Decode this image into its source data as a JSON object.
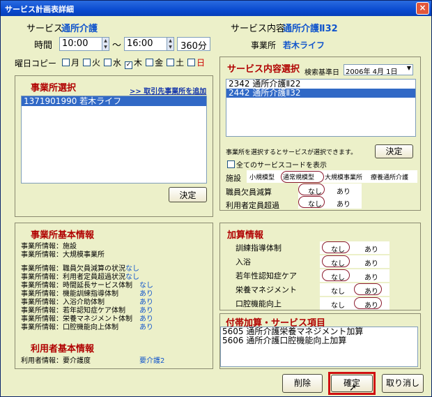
{
  "window": {
    "title": "サービス計画表詳細",
    "close_label": "×"
  },
  "header": {
    "service_label": "サービス",
    "service_value": "通所介護",
    "content_label": "サービス内容",
    "content_value": "通所介護Ⅱ32",
    "time_label": "時間",
    "start_time": "10:00",
    "tilde": "～",
    "end_time": "16:00",
    "duration": "360分",
    "office_label": "事業所",
    "office_value": "若木ライフ"
  },
  "weekday_copy": {
    "label": "曜日コピー",
    "days": [
      {
        "label": "月",
        "checked": false
      },
      {
        "label": "火",
        "checked": false
      },
      {
        "label": "水",
        "checked": false
      },
      {
        "label": "木",
        "checked": true
      },
      {
        "label": "金",
        "checked": false
      },
      {
        "label": "土",
        "checked": false
      },
      {
        "label": "日",
        "checked": false,
        "color": "#cc0000"
      }
    ]
  },
  "office_select": {
    "title": "事業所選択",
    "link": ">> 取引先事業所を追加",
    "items": [
      "1371901990 若木ライフ"
    ],
    "decide": "決定"
  },
  "service_select": {
    "title": "サービス内容選択",
    "base_date_label": "検索基準日",
    "base_date": "2006年 4月 1日",
    "items": [
      "2342 通所介護Ⅱ22",
      "2442 通所介護Ⅱ32"
    ],
    "hint": "事業所を選択するとサービスが選択できます。",
    "decide": "決定",
    "show_all": "全てのサービスコードを表示",
    "facility_label": "施設",
    "facility_options": [
      "小規模型",
      "通常規模型",
      "大規模事業所",
      "療養通所介護"
    ],
    "staff_label": "職員欠員減算",
    "capacity_label": "利用者定員超過",
    "none": "なし",
    "yes": "あり"
  },
  "office_info": {
    "title": "事業所基本情報",
    "rows": [
      {
        "label": "事業所情報：施設",
        "value": ""
      },
      {
        "label": "事業所情報：大規模事業所",
        "value": ""
      },
      {
        "label": "事業所情報：職員欠員減算の状況",
        "value": "なし"
      },
      {
        "label": "事業所情報：利用者定員超過状況",
        "value": "なし"
      },
      {
        "label": "事業所情報：時間延長サービス体制",
        "value": "なし"
      },
      {
        "label": "事業所情報：機能訓練指導体制",
        "value": "あり"
      },
      {
        "label": "事業所情報：入浴介助体制",
        "value": "あり"
      },
      {
        "label": "事業所情報：若年認知症ケア体制",
        "value": "あり"
      },
      {
        "label": "事業所情報：栄養マネジメント体制",
        "value": "あり"
      },
      {
        "label": "事業所情報：口腔機能向上体制",
        "value": "あり"
      }
    ]
  },
  "user_info": {
    "title": "利用者基本情報",
    "label": "利用者情報：要介護度",
    "value": "要介護2"
  },
  "additions": {
    "title": "加算情報",
    "rows": [
      {
        "label": "訓練指導体制",
        "none": "なし",
        "yes": "あり",
        "selected": "none"
      },
      {
        "label": "入浴",
        "none": "なし",
        "yes": "あり",
        "selected": "none"
      },
      {
        "label": "若年性認知症ケア",
        "none": "なし",
        "yes": "あり",
        "selected": "none"
      },
      {
        "label": "栄養マネジメント",
        "none": "なし",
        "yes": "あり",
        "selected": "yes"
      },
      {
        "label": "口腔機能向上",
        "none": "なし",
        "yes": "あり",
        "selected": "yes"
      }
    ]
  },
  "extras": {
    "title": "付帯加算・サービス項目",
    "items": [
      "5605 通所介護栄養マネジメント加算",
      "5606 通所介護口腔機能向上加算"
    ]
  },
  "footer": {
    "delete": "削除",
    "confirm": "確定",
    "cancel": "取り消し"
  }
}
